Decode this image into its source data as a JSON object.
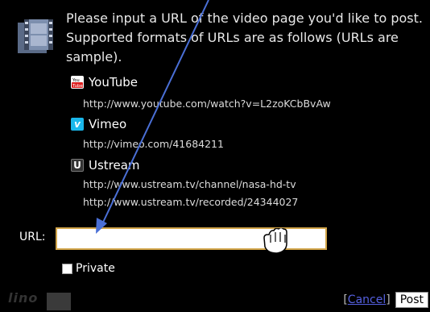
{
  "intro": "Please input a URL of the video page you'd like to post. Supported formats of URLs are as follows (URLs are sample).",
  "services": [
    {
      "name": "YouTube",
      "icon": "youtube-icon",
      "urls": [
        "http://www.youtube.com/watch?v=L2zoKCbBvAw"
      ]
    },
    {
      "name": "Vimeo",
      "icon": "vimeo-icon",
      "urls": [
        "http://vimeo.com/41684211"
      ]
    },
    {
      "name": "Ustream",
      "icon": "ustream-icon",
      "urls": [
        "http://www.ustream.tv/channel/nasa-hd-tv",
        "http://www.ustream.tv/recorded/24344027"
      ]
    }
  ],
  "form": {
    "url_label": "URL:",
    "url_value": "",
    "private_label": "Private",
    "private_checked": false
  },
  "actions": {
    "bracket_open": "[",
    "cancel_label": "Cancel",
    "bracket_close": "]",
    "post_label": "Post"
  },
  "logo": {
    "text": "lino"
  },
  "colors": {
    "input_border": "#d2a54a",
    "arrow": "#4a6fd6",
    "link": "#5560e0"
  }
}
